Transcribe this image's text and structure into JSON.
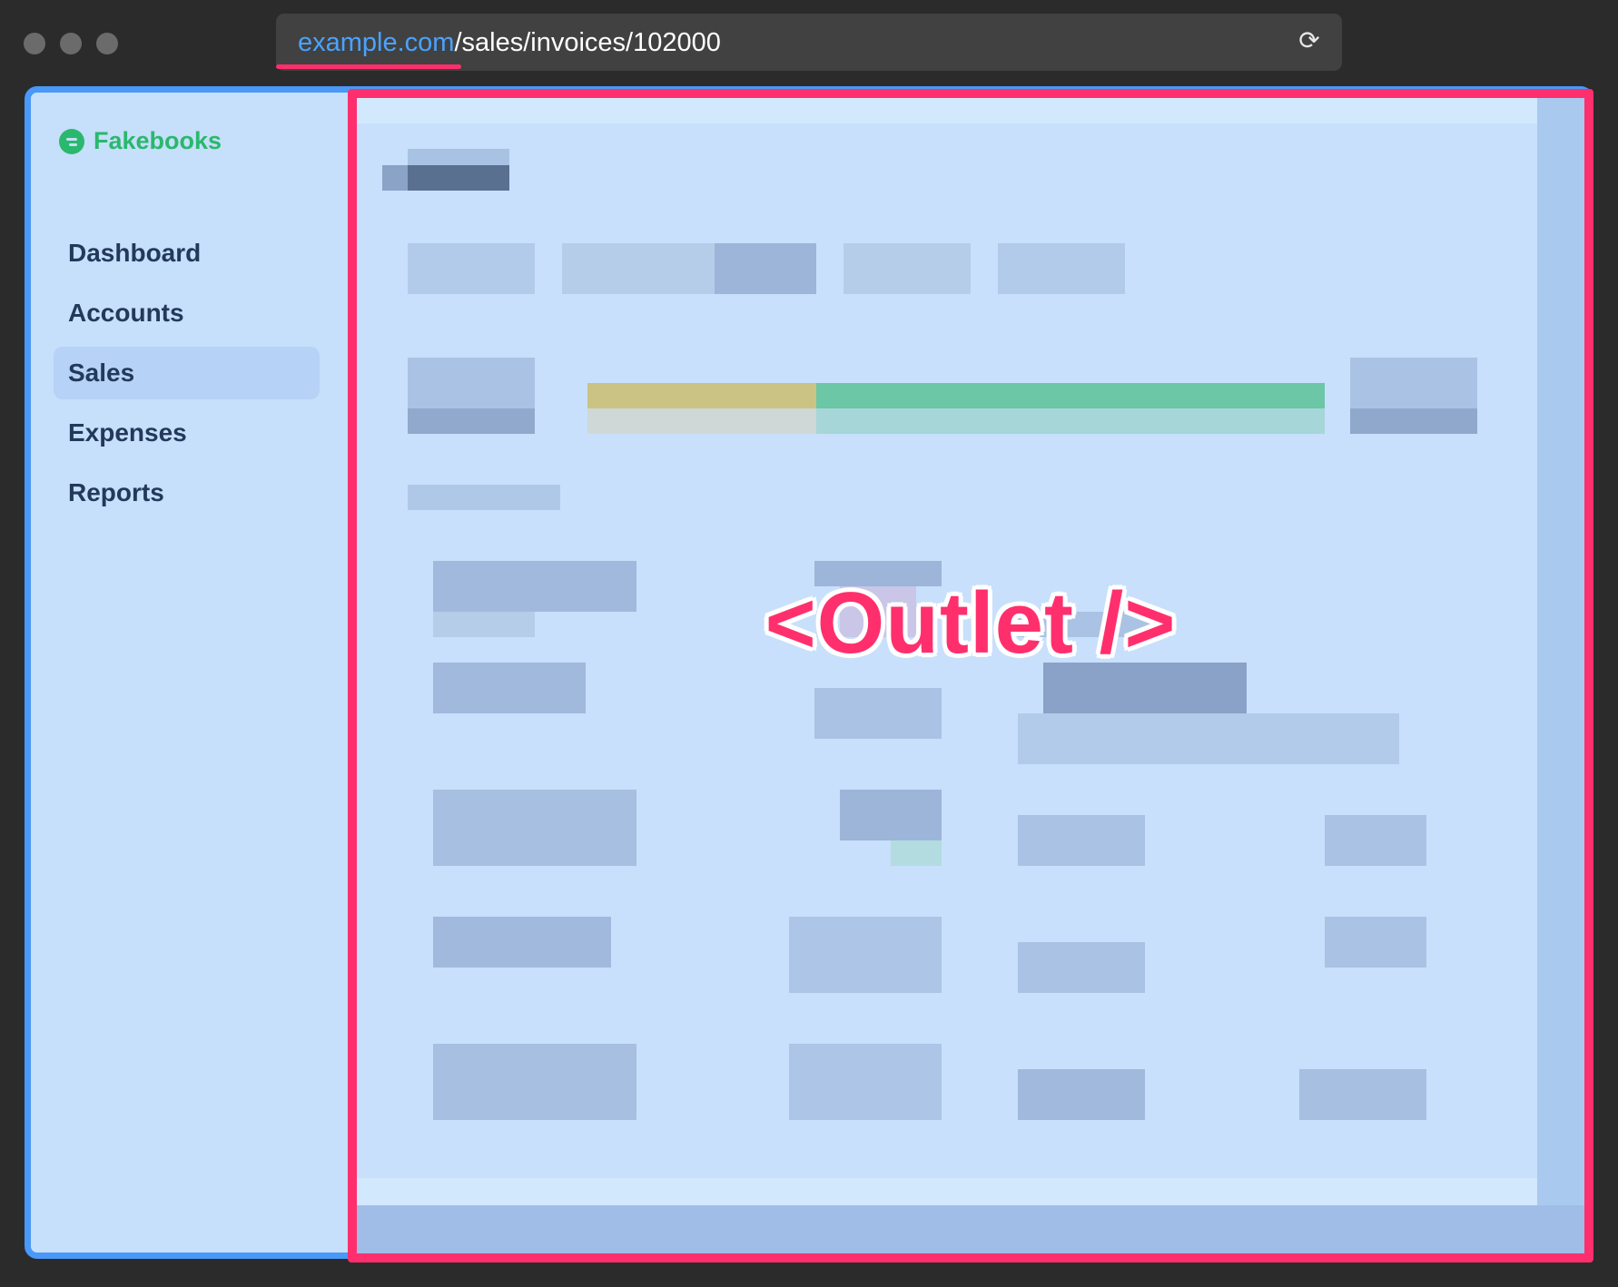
{
  "browser": {
    "url_host": "example.com",
    "url_path": "/sales/invoices/102000"
  },
  "sidebar": {
    "brand": "Fakebooks",
    "items": [
      {
        "label": "Dashboard",
        "active": false
      },
      {
        "label": "Accounts",
        "active": false
      },
      {
        "label": "Sales",
        "active": true
      },
      {
        "label": "Expenses",
        "active": false
      },
      {
        "label": "Reports",
        "active": false
      }
    ]
  },
  "outlet": {
    "label": "<Outlet />"
  },
  "colors": {
    "accent_pink": "#ff2f6d",
    "app_border_blue": "#4a98f7",
    "brand_green": "#2ab86d",
    "nav_text": "#23395b"
  }
}
